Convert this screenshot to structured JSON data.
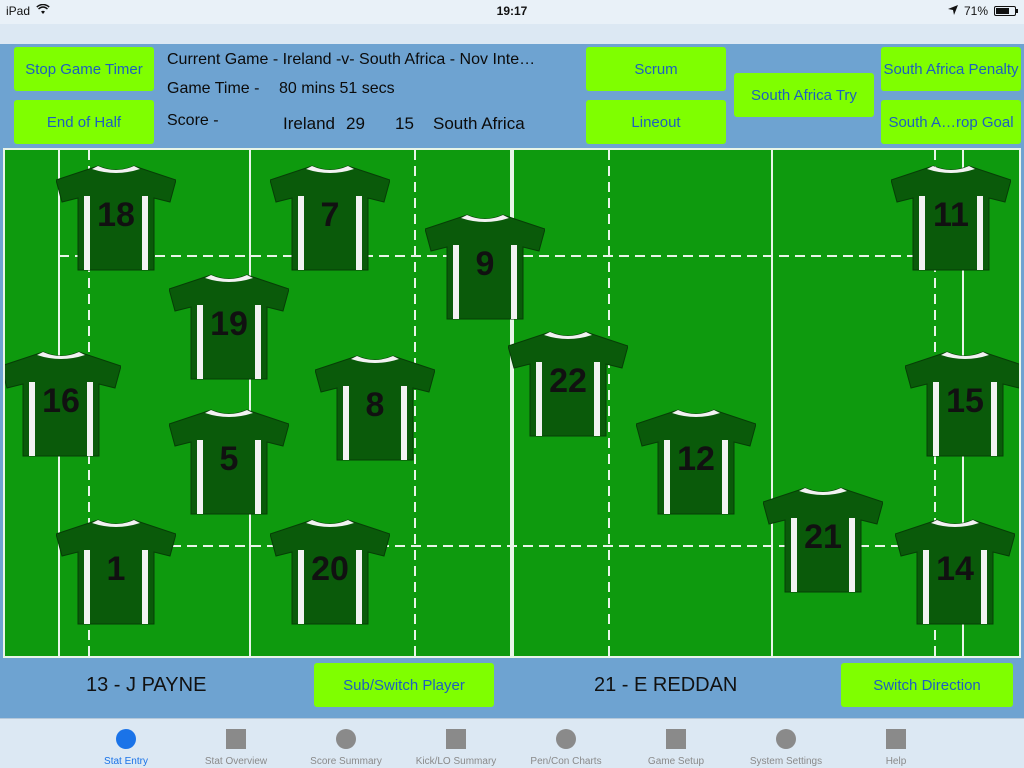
{
  "status_bar": {
    "device": "iPad",
    "time": "19:17",
    "battery": "71%",
    "battery_level": 0.71
  },
  "header": {
    "current_game": "Current Game - Ireland -v- South Africa - Nov Inte…",
    "game_time_label": "Game Time -",
    "game_time_value": "80  mins  51  secs",
    "score_label": "Score -",
    "home_team": "Ireland",
    "home_score": "29",
    "away_score": "15",
    "away_team": "South Africa"
  },
  "buttons": {
    "stop_timer": "Stop Game Timer",
    "end_half": "End of Half",
    "scrum": "Scrum",
    "lineout": "Lineout",
    "try": "South Africa Try",
    "penalty": "South Africa Penalty",
    "drop_goal": "South A…rop Goal",
    "sub_switch": "Sub/Switch Player",
    "switch_direction": "Switch Direction"
  },
  "players": [
    "18",
    "7",
    "9",
    "11",
    "19",
    "16",
    "8",
    "22",
    "15",
    "5",
    "12",
    "21",
    "1",
    "20",
    "14"
  ],
  "bottom": {
    "left_player": "13 - J PAYNE",
    "right_player": "21 - E REDDAN"
  },
  "tabs": [
    {
      "label": "Stat Entry",
      "icon": "circle-icon",
      "active": true
    },
    {
      "label": "Stat Overview",
      "icon": "square-icon",
      "active": false
    },
    {
      "label": "Score Summary",
      "icon": "circle-icon",
      "active": false
    },
    {
      "label": "Kick/LO Summary",
      "icon": "square-icon",
      "active": false
    },
    {
      "label": "Pen/Con Charts",
      "icon": "circle-icon",
      "active": false
    },
    {
      "label": "Game Setup",
      "icon": "square-icon",
      "active": false
    },
    {
      "label": "System Settings",
      "icon": "circle-icon",
      "active": false
    },
    {
      "label": "Help",
      "icon": "square-icon",
      "active": false
    }
  ],
  "colors": {
    "button_bg": "#7fff00",
    "button_text": "#1e5fbf",
    "pitch": "#0e9a0e",
    "jersey": "#0a5a0a",
    "active_tab": "#1a73e8"
  }
}
